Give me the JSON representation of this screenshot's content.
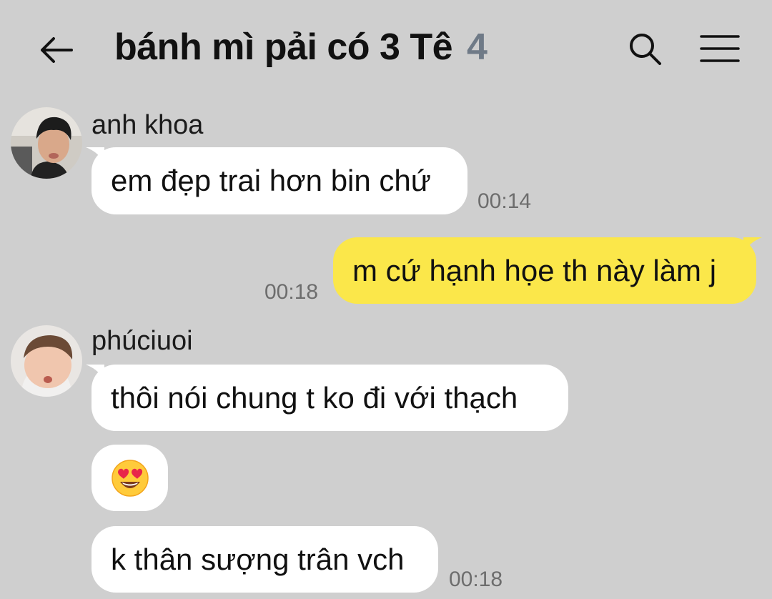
{
  "header": {
    "title": "bánh mì pải có 3 Tê",
    "member_count": "4",
    "back_icon": "arrow-left-icon",
    "search_icon": "search-icon",
    "menu_icon": "hamburger-menu-icon"
  },
  "messages": [
    {
      "sender": "anh khoa",
      "text": "em đẹp trai hơn bin chứ",
      "time": "00:14"
    },
    {
      "sender": "me",
      "text": "m cứ hạnh họe th này làm j",
      "time": "00:18"
    },
    {
      "sender": "phúciuoi",
      "texts": [
        "thôi nói chung t ko đi với thạch",
        "😍",
        "k thân sượng trân vch"
      ],
      "time": "00:18"
    }
  ],
  "colors": {
    "background": "#cfcfcf",
    "incoming_bubble": "#ffffff",
    "outgoing_bubble": "#fbe74a",
    "member_count": "#6f7a87",
    "timestamp": "#6d6d6d"
  }
}
